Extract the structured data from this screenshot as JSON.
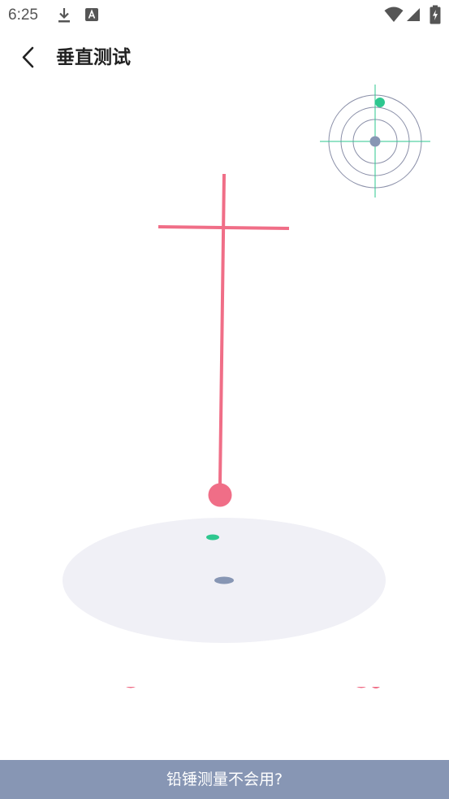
{
  "status_bar": {
    "time": "6:25",
    "icons": [
      "download-icon",
      "accessibility-app-icon",
      "wifi-icon",
      "cell-signal-icon",
      "battery-charging-icon"
    ]
  },
  "header": {
    "back_icon": "chevron-left-icon",
    "title": "垂直测试"
  },
  "footer": {
    "help_label": "铅锤测量不会用?"
  },
  "colors": {
    "plumb_line": "#f06e87",
    "level_indicator": "#2ec78f",
    "center_marker": "#8796b4",
    "base_disc": "#f0f0f6",
    "footer_bg": "#8796b4"
  }
}
